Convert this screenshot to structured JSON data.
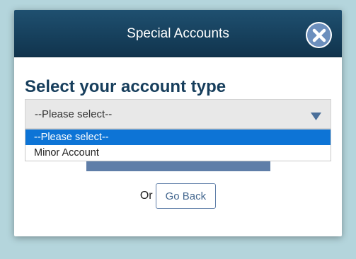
{
  "modal": {
    "title": "Special Accounts",
    "heading": "Select your account type",
    "close_icon": "close-icon"
  },
  "select": {
    "current_value": "--Please select--",
    "arrow_icon": "triangle-down-icon",
    "options": [
      {
        "label": "--Please select--",
        "selected": true
      },
      {
        "label": "Minor Account",
        "selected": false
      }
    ]
  },
  "footer": {
    "or_text": "Or",
    "go_back_label": "Go Back"
  },
  "colors": {
    "header_bg": "#163f5b",
    "heading_text": "#173e5c",
    "accent": "#5f7ea8",
    "selected_option_bg": "#0d74d6",
    "page_bg": "#b4d5dc"
  }
}
